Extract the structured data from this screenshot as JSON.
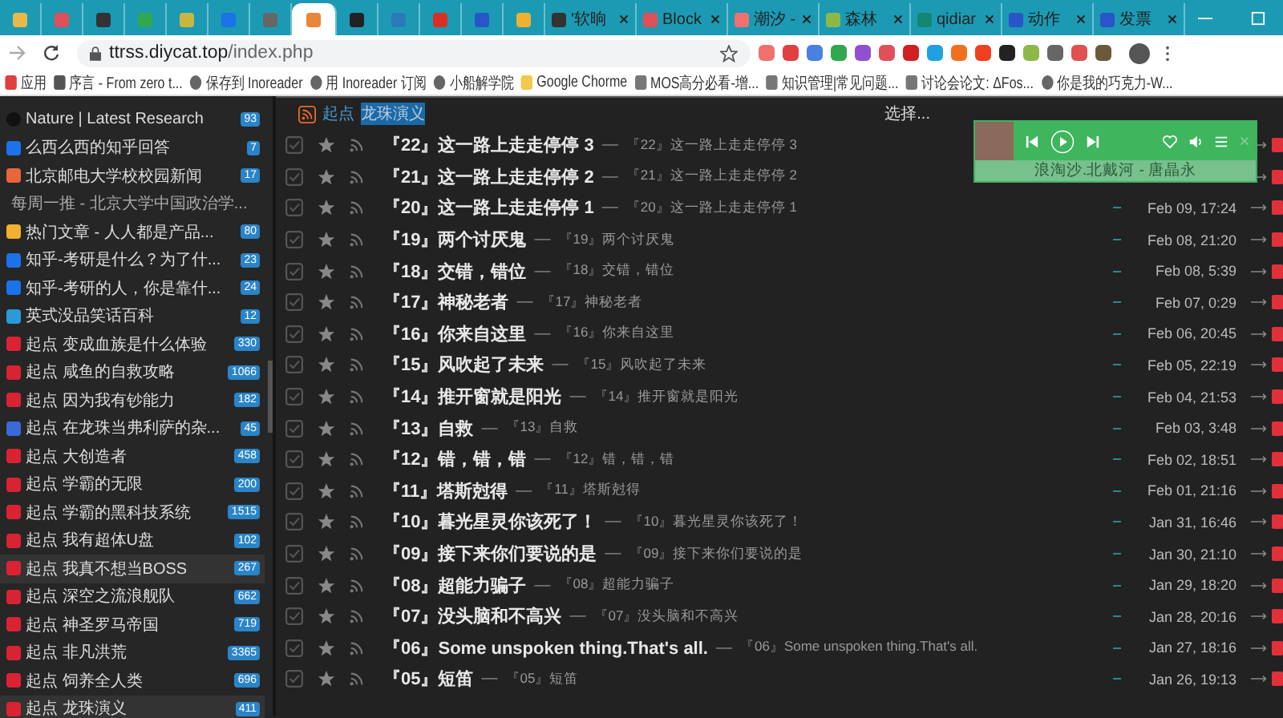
{
  "browser": {
    "tabs": [
      {
        "color": "#e8b84a",
        "selected": false
      },
      {
        "color": "#e0505a",
        "selected": false
      },
      {
        "color": "#333333",
        "selected": false
      },
      {
        "color": "#2fa84f",
        "selected": false
      },
      {
        "color": "#c9b640",
        "selected": false
      },
      {
        "color": "#1a73e8",
        "selected": false
      },
      {
        "color": "#666666",
        "selected": false
      },
      {
        "color": "#e8863a",
        "selected": true
      },
      {
        "color": "#222222",
        "selected": false
      },
      {
        "color": "#2a7ab8",
        "selected": false
      },
      {
        "color": "#d93025",
        "selected": false
      },
      {
        "color": "#2855c8",
        "selected": false
      },
      {
        "color": "#f0b030",
        "selected": false
      },
      {
        "color": "#333333",
        "title": "'软晌",
        "selected": false
      },
      {
        "color": "#e0505a",
        "title": "Block",
        "selected": false
      },
      {
        "color": "#f07070",
        "title": "潮汐 -",
        "selected": false
      },
      {
        "color": "#8cb84a",
        "title": "森林",
        "selected": false
      },
      {
        "color": "#128870",
        "title": "qidiar",
        "selected": false
      },
      {
        "color": "#2855c8",
        "title": "动作",
        "selected": false
      },
      {
        "color": "#2855c8",
        "title": "发票",
        "selected": false
      }
    ],
    "url_host": "ttrss.diycat.top",
    "url_path": "/index.php",
    "bookmarks": [
      {
        "kind": "apps",
        "label": "应用"
      },
      {
        "kind": "book",
        "label": "序言 - From zero t..."
      },
      {
        "kind": "globe",
        "label": "保存到 Inoreader"
      },
      {
        "kind": "globe",
        "label": "用 Inoreader 订阅"
      },
      {
        "kind": "globe",
        "label": "小船解学院"
      },
      {
        "kind": "folder",
        "label": "Google Chorme"
      },
      {
        "kind": "page",
        "label": "MOS高分必看-增..."
      },
      {
        "kind": "page",
        "label": "知识管理|常见问题..."
      },
      {
        "kind": "page",
        "label": "讨论会论文: ΔFos..."
      },
      {
        "kind": "globe",
        "label": "你是我的巧克力-W..."
      }
    ]
  },
  "sidebar": {
    "feeds": [
      {
        "kind": "nature",
        "title": "Nature | Latest Research",
        "count": "93",
        "selected": false
      },
      {
        "kind": "zhihu",
        "title": "么西么西的知乎回答",
        "count": "7",
        "selected": false
      },
      {
        "kind": "bupt",
        "title": "北京邮电大学校校园新闻",
        "count": "17",
        "selected": false
      },
      {
        "kind": "none",
        "title": "每周一推 - 北京大学中国政治学...",
        "selected": false
      },
      {
        "kind": "hot",
        "title": "热门文章 - 人人都是产品...",
        "count": "80",
        "selected": false
      },
      {
        "kind": "zhihu",
        "title": "知乎-考研是什么？为了什...",
        "count": "23",
        "selected": false
      },
      {
        "kind": "zhihu",
        "title": "知乎-考研的人，你是靠什...",
        "count": "24",
        "selected": false
      },
      {
        "kind": "telegram",
        "title": "英式没品笑话百科",
        "count": "12",
        "selected": false
      },
      {
        "kind": "qidian",
        "title": "起点 变成血族是什么体验",
        "count": "330",
        "selected": false
      },
      {
        "kind": "qidian",
        "title": "起点 咸鱼的自救攻略",
        "count": "1066",
        "selected": false
      },
      {
        "kind": "qidian",
        "title": "起点 因为我有钞能力",
        "count": "182",
        "selected": false
      },
      {
        "kind": "qidian-blue",
        "title": "起点 在龙珠当弗利萨的杂...",
        "count": "45",
        "selected": false
      },
      {
        "kind": "qidian",
        "title": "起点 大创造者",
        "count": "458",
        "selected": false
      },
      {
        "kind": "qidian",
        "title": "起点 学霸的无限",
        "count": "200",
        "selected": false
      },
      {
        "kind": "qidian",
        "title": "起点 学霸的黑科技系统",
        "count": "1515",
        "selected": false
      },
      {
        "kind": "qidian",
        "title": "起点 我有超体U盘",
        "count": "102",
        "selected": false
      },
      {
        "kind": "qidian",
        "title": "起点 我真不想当BOSS",
        "count": "267",
        "selected": true
      },
      {
        "kind": "qidian",
        "title": "起点 深空之流浪舰队",
        "count": "662",
        "selected": false
      },
      {
        "kind": "qidian",
        "title": "起点 神圣罗马帝国",
        "count": "719",
        "selected": false
      },
      {
        "kind": "qidian",
        "title": "起点 非凡洪荒",
        "count": "3365",
        "selected": false
      },
      {
        "kind": "qidian",
        "title": "起点 饲养全人类",
        "count": "696",
        "selected": false
      },
      {
        "kind": "qidian",
        "title": "起点 龙珠演义",
        "count": "411",
        "selected": true
      }
    ]
  },
  "headlines": {
    "feed_prefix": "起点",
    "feed_name": "龙珠演义",
    "select_menu": "选择...",
    "separator": "—",
    "rows": [
      {
        "title": "『22』这一路上走走停停 3",
        "excerpt": "『22』这一路上走走停停 3",
        "checked": false
      },
      {
        "title": "『21』这一路上走走停停 2",
        "excerpt": "『21』这一路上走走停停 2",
        "checked": false
      },
      {
        "title": "『20』这一路上走走停停 1",
        "excerpt": "『20』这一路上走走停停 1",
        "date": "Feb 09, 17:24",
        "checked": false
      },
      {
        "title": "『19』两个讨厌鬼",
        "excerpt": "『19』两个讨厌鬼",
        "date": "Feb 08, 21:20",
        "checked": false
      },
      {
        "title": "『18』交错，错位",
        "excerpt": "『18』交错，错位",
        "date": "Feb 08, 5:39",
        "checked": false
      },
      {
        "title": "『17』神秘老者",
        "excerpt": "『17』神秘老者",
        "date": "Feb 07, 0:29",
        "checked": false
      },
      {
        "title": "『16』你来自这里",
        "excerpt": "『16』你来自这里",
        "date": "Feb 06, 20:45",
        "checked": false
      },
      {
        "title": "『15』风吹起了未来",
        "excerpt": "『15』风吹起了未来",
        "date": "Feb 05, 22:19",
        "checked": false
      },
      {
        "title": "『14』推开窗就是阳光",
        "excerpt": "『14』推开窗就是阳光",
        "date": "Feb 04, 21:53",
        "checked": false
      },
      {
        "title": "『13』自救",
        "excerpt": "『13』自救",
        "date": "Feb 03, 3:48",
        "checked": false
      },
      {
        "title": "『12』错，错，错",
        "excerpt": "『12』错，错，错",
        "date": "Feb 02, 18:51",
        "checked": false
      },
      {
        "title": "『11』塔斯尅得",
        "excerpt": "『11』塔斯尅得",
        "date": "Feb 01, 21:16",
        "checked": false
      },
      {
        "title": "『10』暮光星灵你该死了！",
        "excerpt": "『10』暮光星灵你该死了！",
        "date": "Jan 31, 16:46",
        "checked": false
      },
      {
        "title": "『09』接下来你们要说的是",
        "excerpt": "『09』接下来你们要说的是",
        "date": "Jan 30, 21:10",
        "checked": false
      },
      {
        "title": "『08』超能力骗子",
        "excerpt": "『08』超能力骗子",
        "date": "Jan 29, 18:20",
        "checked": false
      },
      {
        "title": "『07』没头脑和不高兴",
        "excerpt": "『07』没头脑和不高兴",
        "date": "Jan 28, 20:16",
        "checked": false
      },
      {
        "title": "『06』Some unspoken thing.That's all.",
        "excerpt": "『06』Some unspoken thing.That's all.",
        "date": "Jan 27, 18:16",
        "checked": false
      },
      {
        "title": "『05』短笛",
        "excerpt": "『05』短笛",
        "date": "Jan 26, 19:13",
        "checked": false
      }
    ]
  },
  "player": {
    "song": "浪淘沙.北戴河 - 唐晶永"
  }
}
